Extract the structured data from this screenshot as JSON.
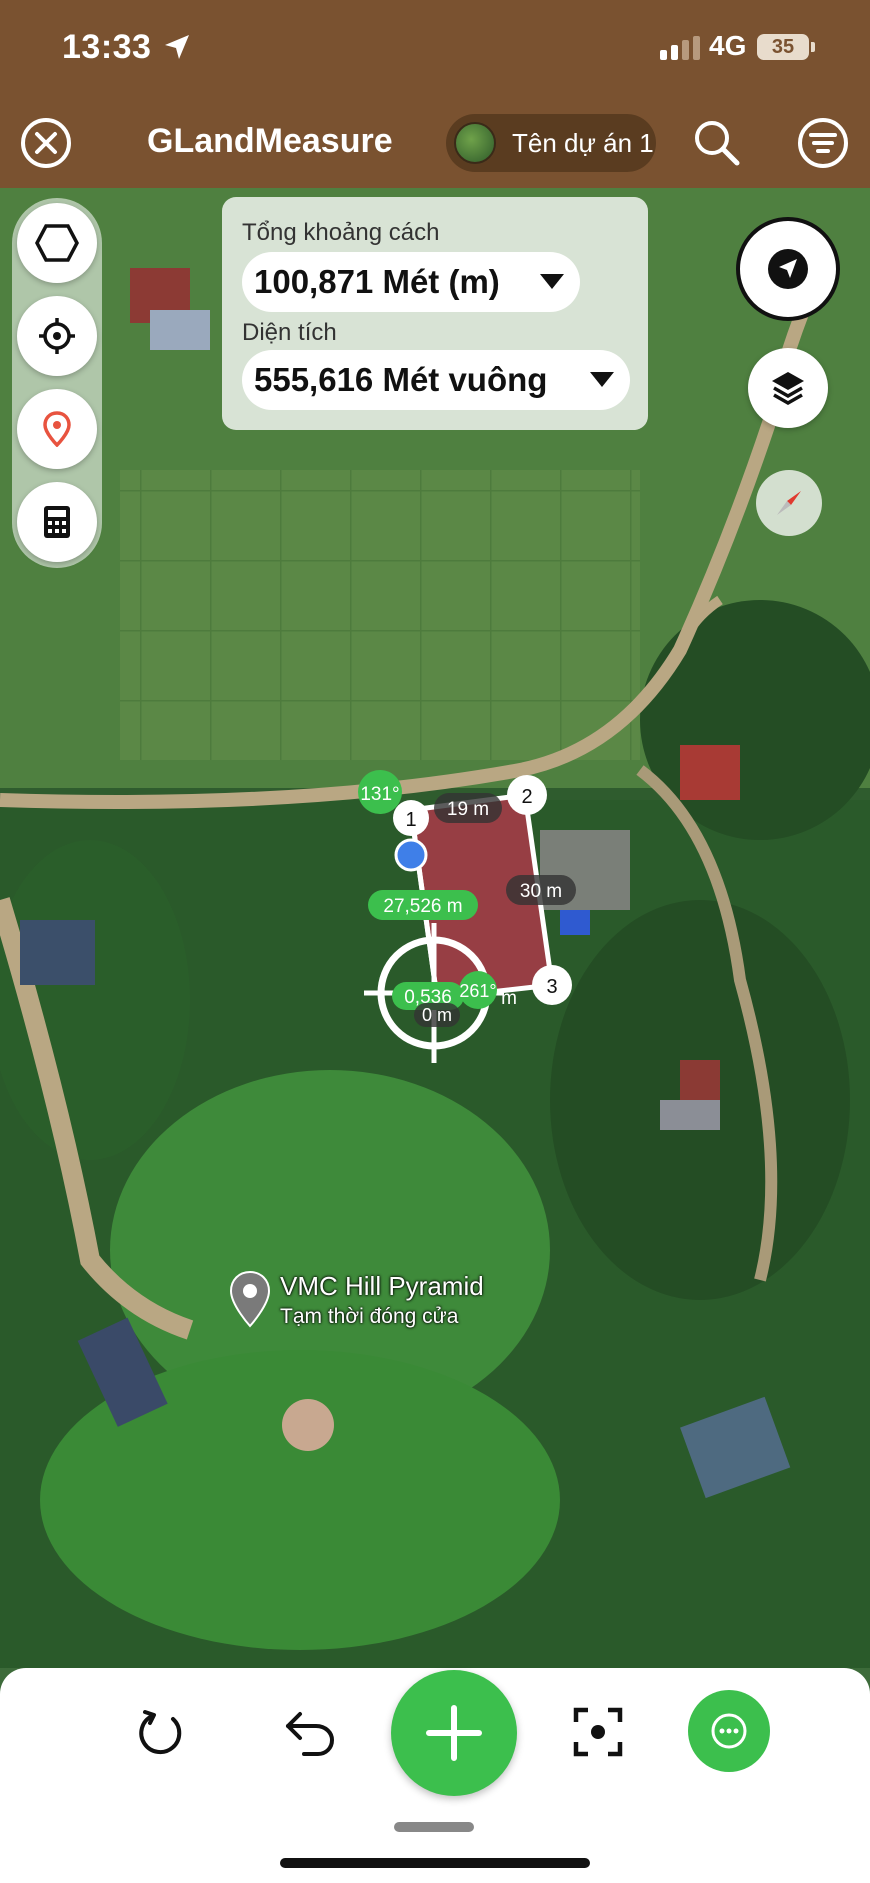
{
  "status_bar": {
    "time": "13:33",
    "network": "4G",
    "battery": "35"
  },
  "header": {
    "title": "GLandMeasure",
    "project_name": "Tên dự án 1"
  },
  "measure": {
    "distance_label": "Tổng khoảng cách",
    "distance_value": "100,871 Mét (m)",
    "area_label": "Diện tích",
    "area_value": "555,616 Mét vuông"
  },
  "map": {
    "angle_label": "131°",
    "points": [
      "1",
      "2",
      "3"
    ],
    "segment_labels": [
      "19 m",
      "30 m",
      "27,526 m",
      "0,536",
      "261°",
      "m",
      "0 m"
    ],
    "poi_name": "VMC Hill Pyramid",
    "poi_status": "Tạm thời đóng cửa"
  },
  "colors": {
    "header": "#7a5230",
    "accent_green": "#3cbf4d",
    "polygon_fill": "#c2334f",
    "point_blue": "#3f7fe8"
  },
  "icons": {
    "left_tools": [
      "polygon-icon",
      "crosshair-icon",
      "pin-icon",
      "calculator-icon"
    ],
    "bottom": [
      "rotate-icon",
      "undo-icon",
      "plus-icon",
      "focus-icon",
      "more-icon"
    ]
  }
}
